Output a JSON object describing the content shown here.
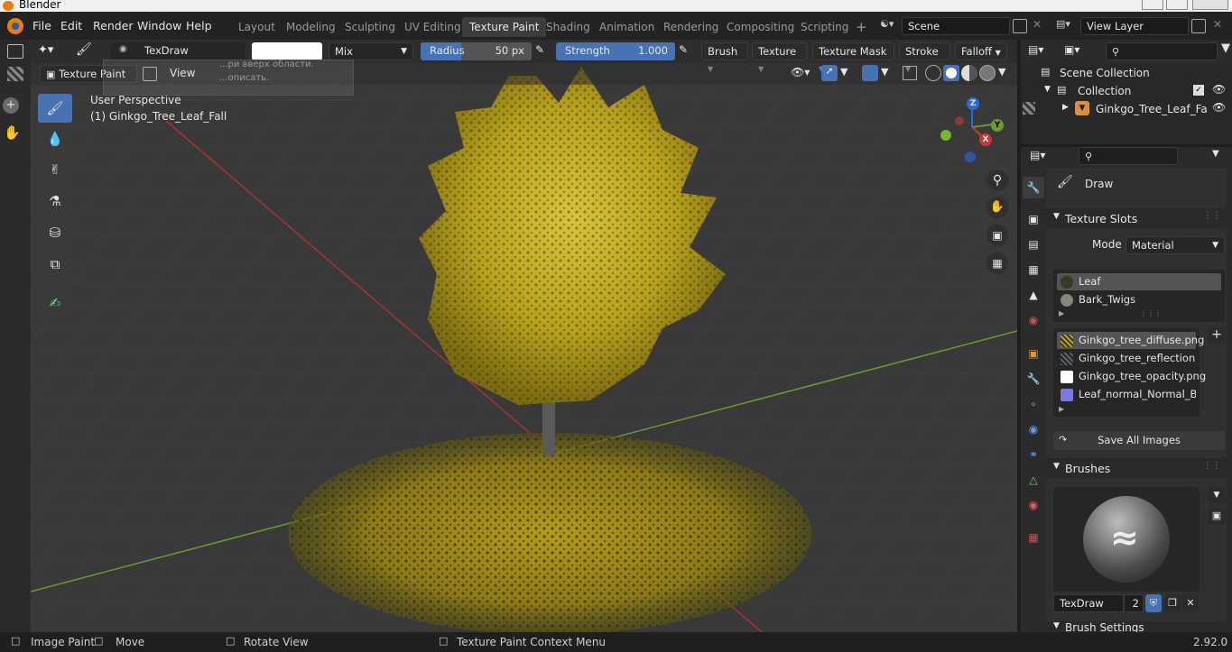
{
  "titlebar": {
    "title": "Blender"
  },
  "menubar": {
    "menus": [
      "File",
      "Edit",
      "Render",
      "Window",
      "Help"
    ],
    "workspaces": [
      "Layout",
      "Modeling",
      "Sculpting",
      "UV Editing",
      "Texture Paint",
      "Shading",
      "Animation",
      "Rendering",
      "Compositing",
      "Scripting"
    ],
    "active_workspace": "Texture Paint",
    "add_tab": "+",
    "scene": "Scene",
    "view_layer": "View Layer"
  },
  "tool_header": {
    "brush_name": "TexDraw",
    "blend_mode": "Mix",
    "radius_label": "Radius",
    "radius_value": "50 px",
    "strength_label": "Strength",
    "strength_value": "1.000",
    "menus": [
      "Brush",
      "Texture",
      "Texture Mask",
      "Stroke",
      "Falloff"
    ]
  },
  "viewport_header": {
    "mode": "Texture Paint",
    "view_menu": "View"
  },
  "viewport": {
    "perspective_label": "User Perspective",
    "object_label": "(1) Ginkgo_Tree_Leaf_Fall",
    "gizmo_z": "Z",
    "gizmo_y": "Y",
    "gizmo_x": "X",
    "tooltip_line1": "...ри вверх области.",
    "tooltip_line2": "...описать."
  },
  "outliner": {
    "scene_collection": "Scene Collection",
    "collection": "Collection",
    "object": "Ginkgo_Tree_Leaf_Fa"
  },
  "properties": {
    "tool_name": "Draw",
    "texture_slots_title": "Texture Slots",
    "mode_label": "Mode",
    "mode_value": "Material",
    "materials": [
      "Leaf",
      "Bark_Twigs"
    ],
    "images": [
      "Ginkgo_tree_diffuse.png",
      "Ginkgo_tree_reflection....",
      "Ginkgo_tree_opacity.png",
      "Leaf_normal_Normal_B..."
    ],
    "save_all": "Save All Images",
    "brushes_title": "Brushes",
    "brush_name": "TexDraw",
    "brush_users": "2",
    "brush_settings_title": "Brush Settings",
    "add": "+"
  },
  "statusbar": {
    "image_paint": "Image Paint",
    "move": "Move",
    "rotate_view": "Rotate View",
    "context_menu": "Texture Paint Context Menu",
    "version": "2.92.0"
  },
  "colors": {
    "accent": "#4772b3",
    "foliage": "#b8a21c",
    "active_tab": "#3d3d3d"
  }
}
